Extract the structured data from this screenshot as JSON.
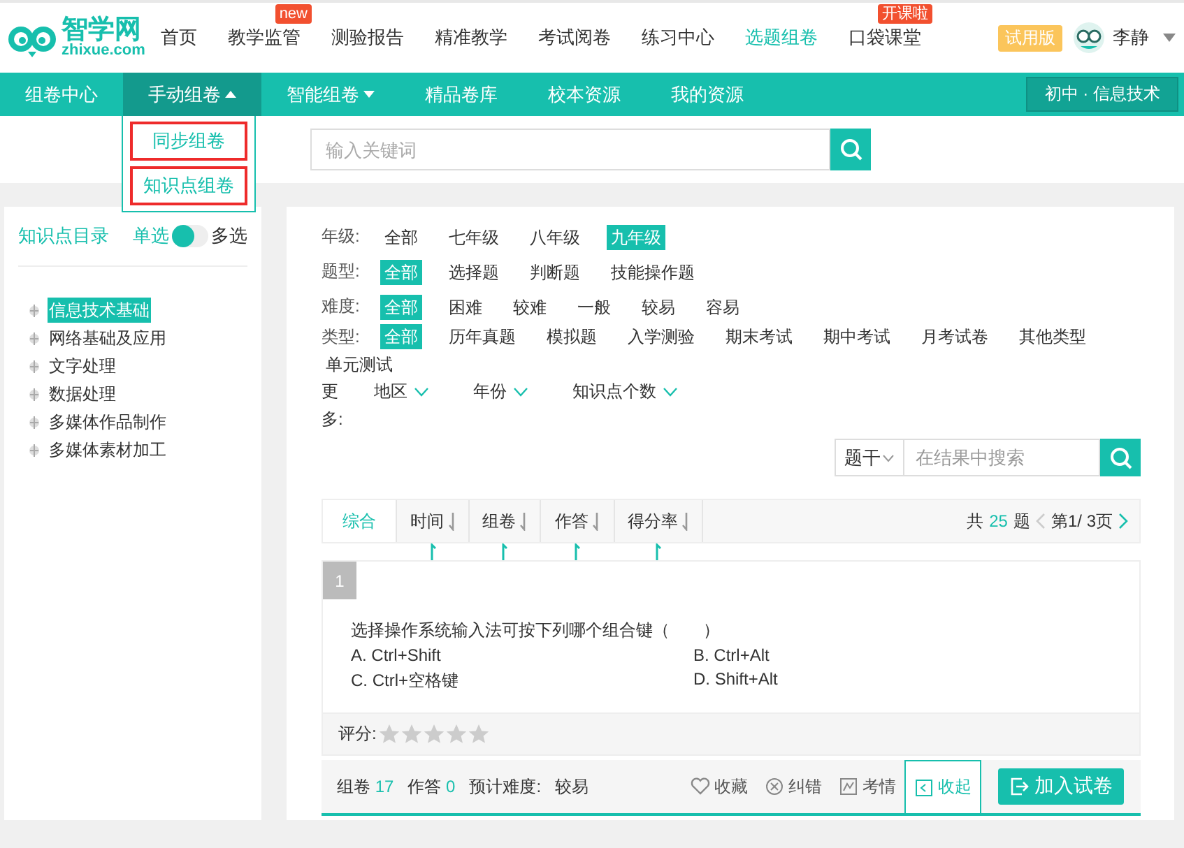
{
  "header": {
    "logo": {
      "name": "智学网",
      "domain": "zhixue.com"
    },
    "nav": [
      {
        "label": "首页",
        "selected": false
      },
      {
        "label": "教学监管",
        "selected": false,
        "badge": "new"
      },
      {
        "label": "测验报告",
        "selected": false
      },
      {
        "label": "精准教学",
        "selected": false
      },
      {
        "label": "考试阅卷",
        "selected": false
      },
      {
        "label": "练习中心",
        "selected": false
      },
      {
        "label": "选题组卷",
        "selected": true
      },
      {
        "label": "口袋课堂",
        "selected": false,
        "badge": "开课啦"
      }
    ],
    "trial": "试用版",
    "user": "李静"
  },
  "subnav": {
    "items": [
      {
        "label": "组卷中心",
        "selected": false,
        "caret": false
      },
      {
        "label": "手动组卷",
        "selected": true,
        "caret": true
      },
      {
        "label": "智能组卷",
        "selected": false,
        "caret": true
      },
      {
        "label": "精品卷库",
        "selected": false,
        "caret": false
      },
      {
        "label": "校本资源",
        "selected": false,
        "caret": false
      },
      {
        "label": "我的资源",
        "selected": false,
        "caret": false
      }
    ],
    "subject": "初中 · 信息技术",
    "dropdown": [
      {
        "label": "同步组卷",
        "outlined": true
      },
      {
        "label": "知识点组卷",
        "outlined": true
      }
    ]
  },
  "search": {
    "placeholder": "输入关键词"
  },
  "sidebar": {
    "title": "知识点目录",
    "toggle": {
      "left": "单选",
      "right": "多选",
      "on": false
    },
    "items": [
      {
        "label": "信息技术基础",
        "selected": true
      },
      {
        "label": "网络基础及应用",
        "selected": false
      },
      {
        "label": "文字处理",
        "selected": false
      },
      {
        "label": "数据处理",
        "selected": false
      },
      {
        "label": "多媒体作品制作",
        "selected": false
      },
      {
        "label": "多媒体素材加工",
        "selected": false
      }
    ]
  },
  "filters": [
    {
      "label": "年级:",
      "options": [
        {
          "label": "全部",
          "selected": false
        },
        {
          "label": "七年级",
          "selected": false
        },
        {
          "label": "八年级",
          "selected": false
        },
        {
          "label": "九年级",
          "selected": true
        }
      ]
    },
    {
      "label": "题型:",
      "options": [
        {
          "label": "全部",
          "selected": true
        },
        {
          "label": "选择题",
          "selected": false
        },
        {
          "label": "判断题",
          "selected": false
        },
        {
          "label": "技能操作题",
          "selected": false
        }
      ]
    },
    {
      "label": "难度:",
      "options": [
        {
          "label": "全部",
          "selected": true
        },
        {
          "label": "困难",
          "selected": false
        },
        {
          "label": "较难",
          "selected": false
        },
        {
          "label": "一般",
          "selected": false
        },
        {
          "label": "较易",
          "selected": false
        },
        {
          "label": "容易",
          "selected": false
        }
      ]
    },
    {
      "label": "类型:",
      "options": [
        {
          "label": "全部",
          "selected": true
        },
        {
          "label": "历年真题",
          "selected": false
        },
        {
          "label": "模拟题",
          "selected": false
        },
        {
          "label": "入学测验",
          "selected": false
        },
        {
          "label": "期末考试",
          "selected": false
        },
        {
          "label": "期中考试",
          "selected": false
        },
        {
          "label": "月考试卷",
          "selected": false
        },
        {
          "label": "其他类型",
          "selected": false
        },
        {
          "label": "单元测试",
          "selected": false
        }
      ]
    }
  ],
  "more": {
    "label": "更多:",
    "dropdowns": [
      "地区",
      "年份",
      "知识点个数"
    ]
  },
  "result_search": {
    "scope": "题干",
    "placeholder": "在结果中搜索"
  },
  "sort_tabs": [
    {
      "label": "综合",
      "selected": true,
      "sortable": false
    },
    {
      "label": "时间",
      "selected": false,
      "sortable": true
    },
    {
      "label": "组卷",
      "selected": false,
      "sortable": true
    },
    {
      "label": "作答",
      "selected": false,
      "sortable": true
    },
    {
      "label": "得分率",
      "selected": false,
      "sortable": true
    }
  ],
  "pager": {
    "prefix": "共",
    "count": "25",
    "suffix": "题",
    "page": "第1/ 3页"
  },
  "question": {
    "number": "1",
    "stem": "选择操作系统输入法可按下列哪个组合键（　　）",
    "options": [
      "A. Ctrl+Shift",
      "B. Ctrl+Alt",
      "C. Ctrl+空格键",
      "D. Shift+Alt"
    ],
    "rating_label": "评分:",
    "stars": 0,
    "stats": [
      {
        "label": "组卷",
        "value": "17"
      },
      {
        "label": "作答",
        "value": "0"
      }
    ],
    "difficulty_label": "预计难度:",
    "difficulty": "较易",
    "actions": [
      {
        "kind": "favorite",
        "label": "收藏",
        "selected": false
      },
      {
        "kind": "report",
        "label": "纠错",
        "selected": false
      },
      {
        "kind": "stats",
        "label": "考情",
        "selected": false
      },
      {
        "kind": "collapse",
        "label": "收起",
        "selected": true
      }
    ],
    "add_button": "加入试卷"
  }
}
